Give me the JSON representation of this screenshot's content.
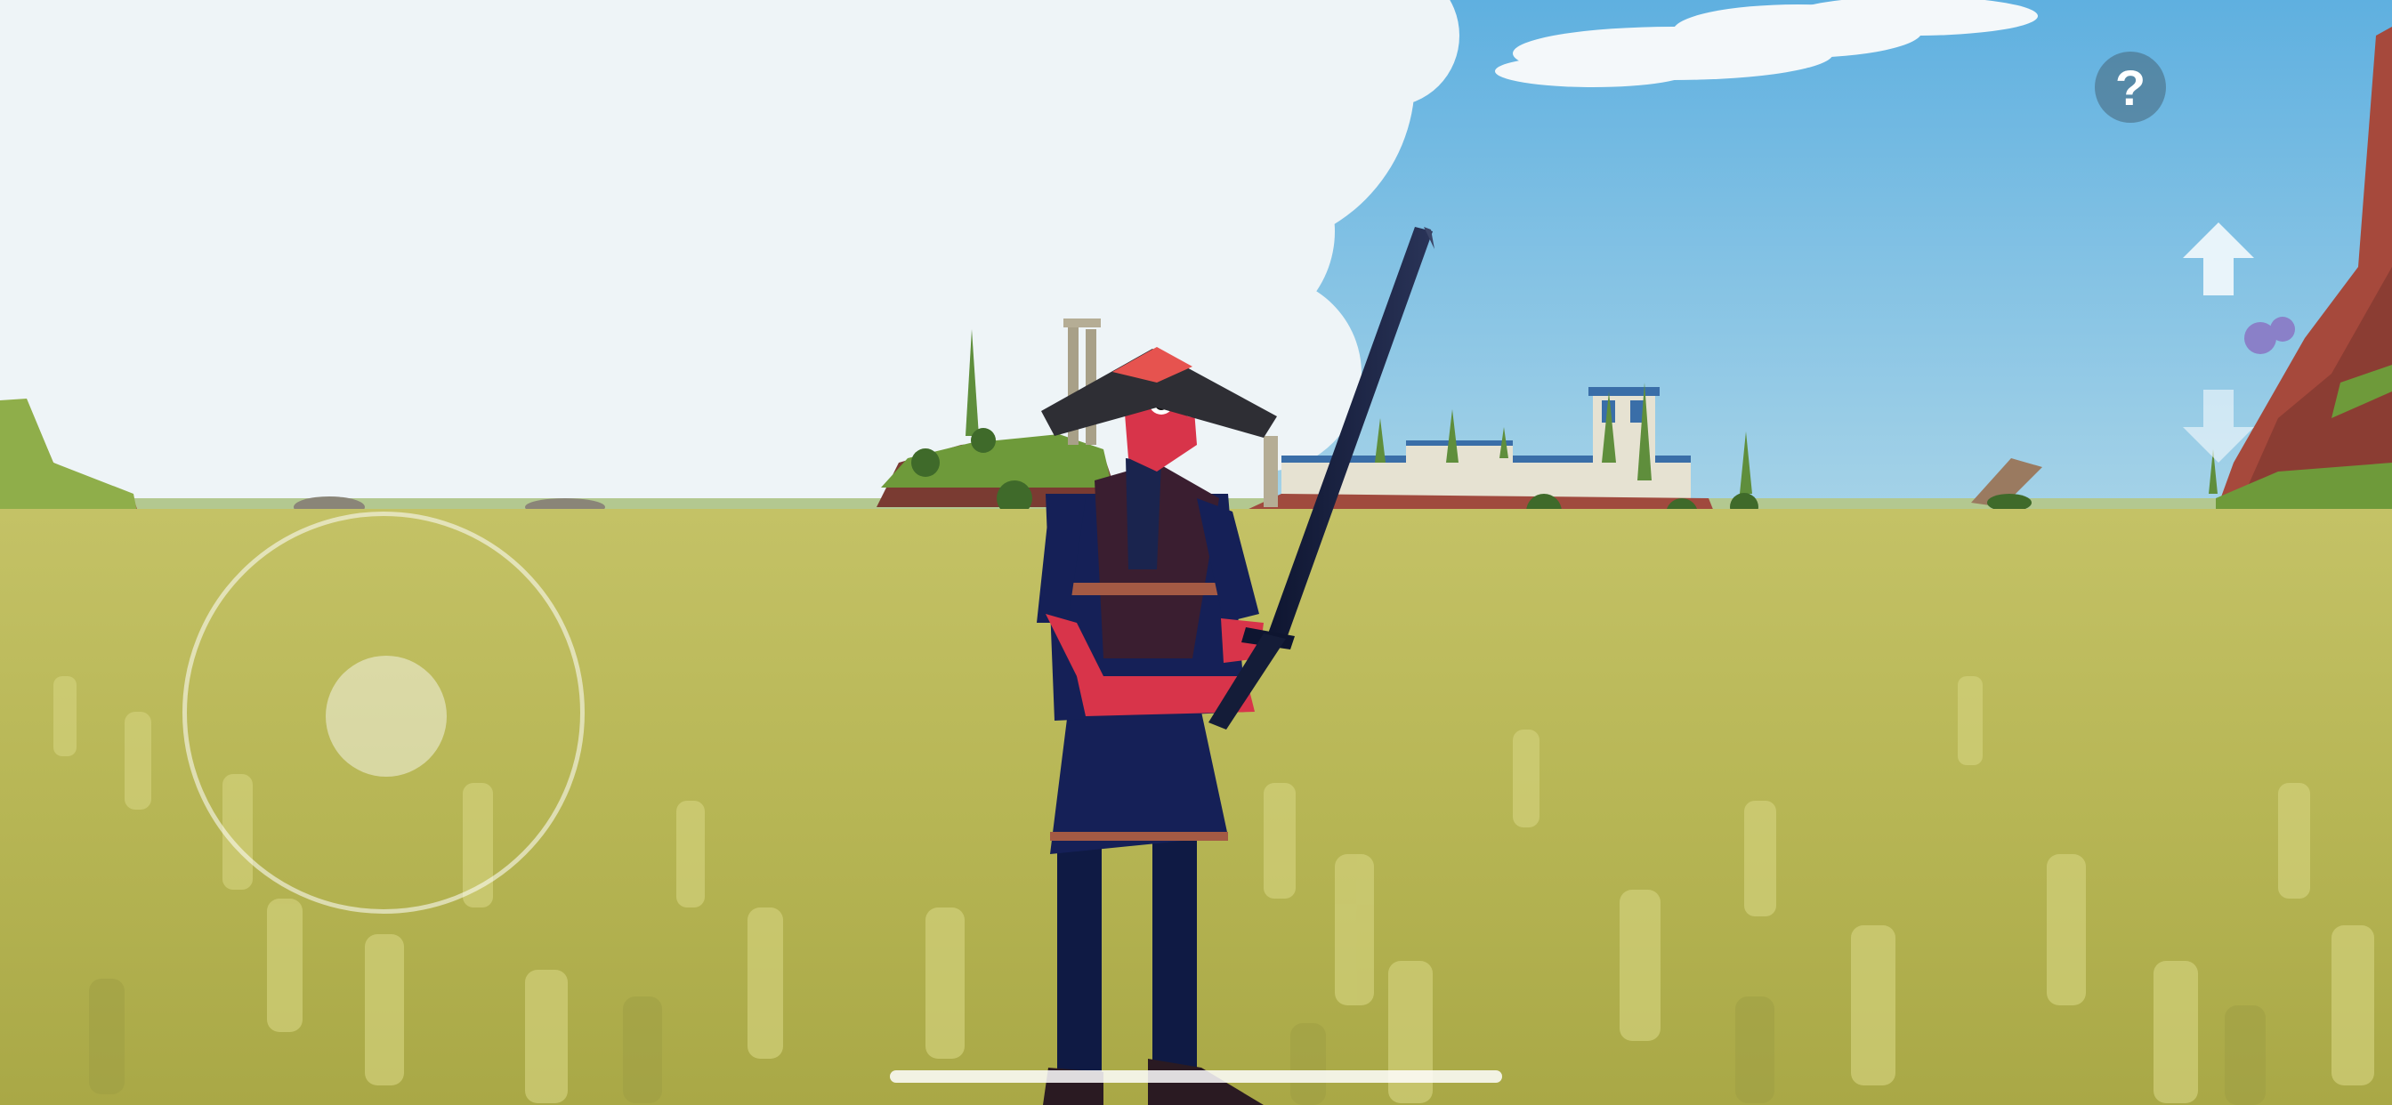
{
  "hud": {
    "help_label": "?",
    "controls": [
      "movement-joystick",
      "camera-up-arrow",
      "camera-down-arrow"
    ]
  },
  "colors": {
    "sky": "#7fbfe0",
    "cloud": "#eef5f8",
    "grass": "#b9b85a",
    "character_skin": "#d8344a",
    "character_outfit": "#16204a",
    "katana": "#141c38",
    "help_button_bg": "#587488"
  }
}
